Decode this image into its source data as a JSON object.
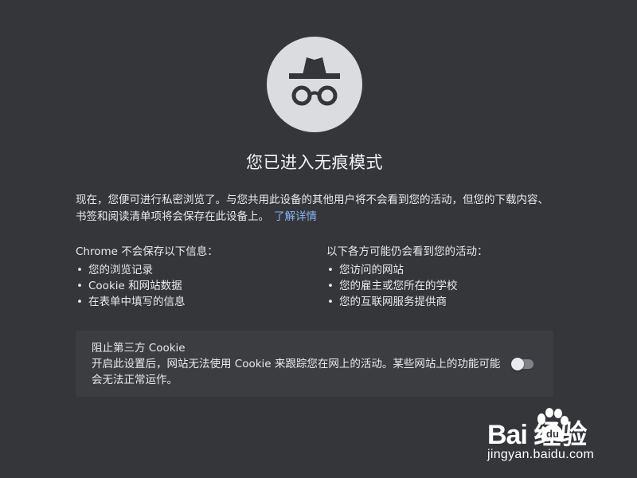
{
  "page": {
    "title": "您已进入无痕模式",
    "intro_text": "现在，您便可进行私密浏览了。与您共用此设备的其他用户将不会看到您的活动，但您的下载内容、书签和阅读清单项将会保存在此设备上。",
    "learn_more": "了解详情"
  },
  "not_saved": {
    "heading": "Chrome 不会保存以下信息：",
    "items": [
      "您的浏览记录",
      "Cookie 和网站数据",
      "在表单中填写的信息"
    ]
  },
  "may_see": {
    "heading": "以下各方可能仍会看到您的活动：",
    "items": [
      "您访问的网站",
      "您的雇主或您所在的学校",
      "您的互联网服务提供商"
    ]
  },
  "cookie_card": {
    "title": "阻止第三方 Cookie",
    "description": "开启此设置后，网站无法使用 Cookie 来跟踪您在网上的活动。某些网站上的功能可能会无法正常运作。",
    "toggle_on": false
  },
  "bullet": "•",
  "watermark": {
    "logo": "Bai 经验",
    "url": "jingyan.baidu.com"
  },
  "icons": {
    "hero": "incognito-icon"
  },
  "colors": {
    "background": "#35363a",
    "card": "#3c3d41",
    "link": "#8ab4f8",
    "hero_circle": "#dadce0"
  }
}
